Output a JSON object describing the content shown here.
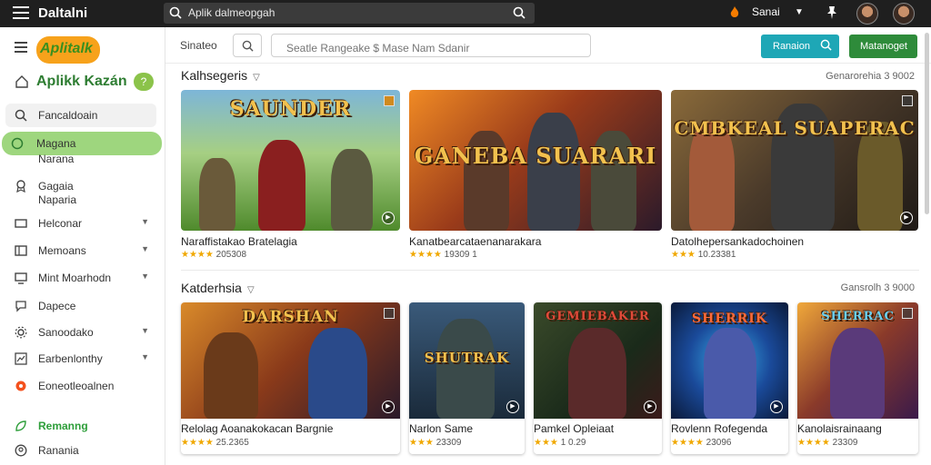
{
  "topbar": {
    "brand": "Daltalni",
    "search_text": "Aplik dalmeopgah",
    "user_label": "Sanai"
  },
  "sidebar": {
    "logo_text": "Aplitalk",
    "app_name": "Aplikk Kazán",
    "badge": "?",
    "items": [
      {
        "label": "Fancaldoain",
        "icon": "search-icon"
      },
      {
        "label": "Magana",
        "icon": "circle-icon"
      },
      {
        "label": "Narana",
        "icon": ""
      },
      {
        "label": "Gagaia",
        "icon": "badge-icon"
      },
      {
        "label": "Naparia",
        "icon": ""
      },
      {
        "label": "Helconar",
        "icon": "monitor-icon"
      },
      {
        "label": "Memoans",
        "icon": "window-icon"
      },
      {
        "label": "Mint Moarhodn",
        "icon": "monitor-icon"
      },
      {
        "label": "Dapece",
        "icon": "chat-icon"
      },
      {
        "label": "Sanoodako",
        "icon": "gear-icon"
      },
      {
        "label": "Earbenlonthy",
        "icon": "chart-icon"
      },
      {
        "label": "Eoneotleoalnen",
        "icon": "orange-dot-icon"
      },
      {
        "label": "Remanng",
        "icon": "leaf-icon"
      },
      {
        "label": "Ranania",
        "icon": "person-icon"
      }
    ]
  },
  "filterbar": {
    "label": "Sinateo",
    "placeholder": "Seatle Rangeake $ Mase Nam Sdanir",
    "btn_primary": "Ranaion",
    "btn_secondary": "Matanoget"
  },
  "sections": [
    {
      "title": "Kalhsegeris",
      "meta": "Genarorehia 3 9002",
      "cards": [
        {
          "art_title": "SAUNDER",
          "title": "Naraffistakao Bratelagia",
          "stars": "★★★★",
          "rating": "205308"
        },
        {
          "art_title": "GANEBA SUARARI",
          "title": "Kanatbearcataenanarakara",
          "stars": "★★★★",
          "rating": "19309 1"
        },
        {
          "art_title": "CMBKEAL SUAPERAC",
          "title": "Datolhepersankadochoinen",
          "stars": "★★★",
          "rating": "10.23381"
        }
      ]
    },
    {
      "title": "Katderhsia",
      "meta": "Gansrolh 3 9000",
      "cards": [
        {
          "art_title": "DARSHAN",
          "title": "Relolag Aoanakokacan Bargnie",
          "stars": "★★★★",
          "rating": "25.2365"
        },
        {
          "art_title": "SHUTRAK",
          "title": "Narlon Same",
          "stars": "★★★",
          "rating": "23309"
        },
        {
          "art_title": "GEMIEBAKER",
          "title": "Pamkel Opleiaat",
          "stars": "★★★",
          "rating": "1 0.29"
        },
        {
          "art_title": "SHERRIK",
          "title": "Rovlenn Rofegenda",
          "stars": "★★★★",
          "rating": "23096"
        },
        {
          "art_title": "SHERRAC",
          "title": "Kanolaisrainaang",
          "stars": "★★★★",
          "rating": "23309"
        }
      ]
    }
  ]
}
